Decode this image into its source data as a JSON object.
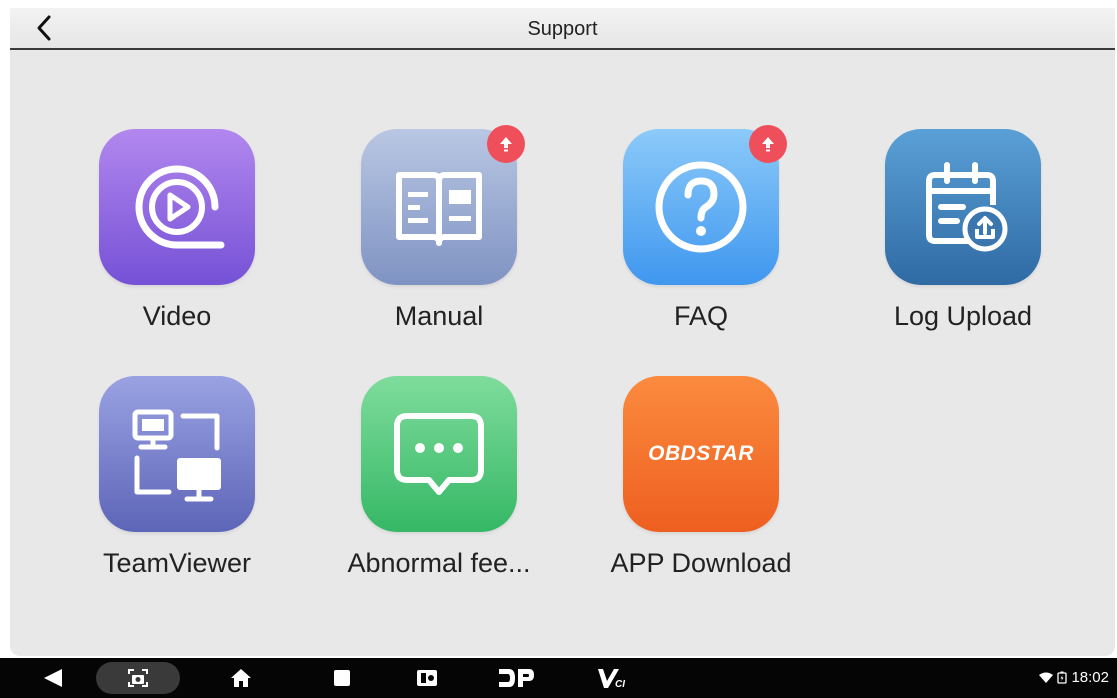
{
  "header": {
    "title": "Support"
  },
  "apps": [
    {
      "label": "Video"
    },
    {
      "label": "Manual"
    },
    {
      "label": "FAQ"
    },
    {
      "label": "Log Upload"
    },
    {
      "label": "TeamViewer"
    },
    {
      "label": "Abnormal fee..."
    },
    {
      "label": "APP Download",
      "logo_text": "OBDSTAR"
    }
  ],
  "status_bar": {
    "time": "18:02"
  },
  "colors": {
    "update_badge": "#ef4f5a",
    "video": "#8a63de",
    "manual": "#8ea4cb",
    "faq": "#4aa3f3",
    "log_upload": "#3f7fb4",
    "teamviewer": "#6f78c6",
    "abnormal_feedback": "#3fc070",
    "app_download": "#f46d26"
  },
  "icons": [
    "back-chevron-icon",
    "play-circle-icon",
    "book-icon",
    "question-circle-icon",
    "clipboard-upload-icon",
    "remote-desktop-icon",
    "chat-bubble-icon",
    "obdstar-logo",
    "update-arrow-icon",
    "nav-back-icon",
    "screenshot-icon",
    "home-icon",
    "recents-icon",
    "dp-icon",
    "vci-icon",
    "wifi-icon"
  ]
}
